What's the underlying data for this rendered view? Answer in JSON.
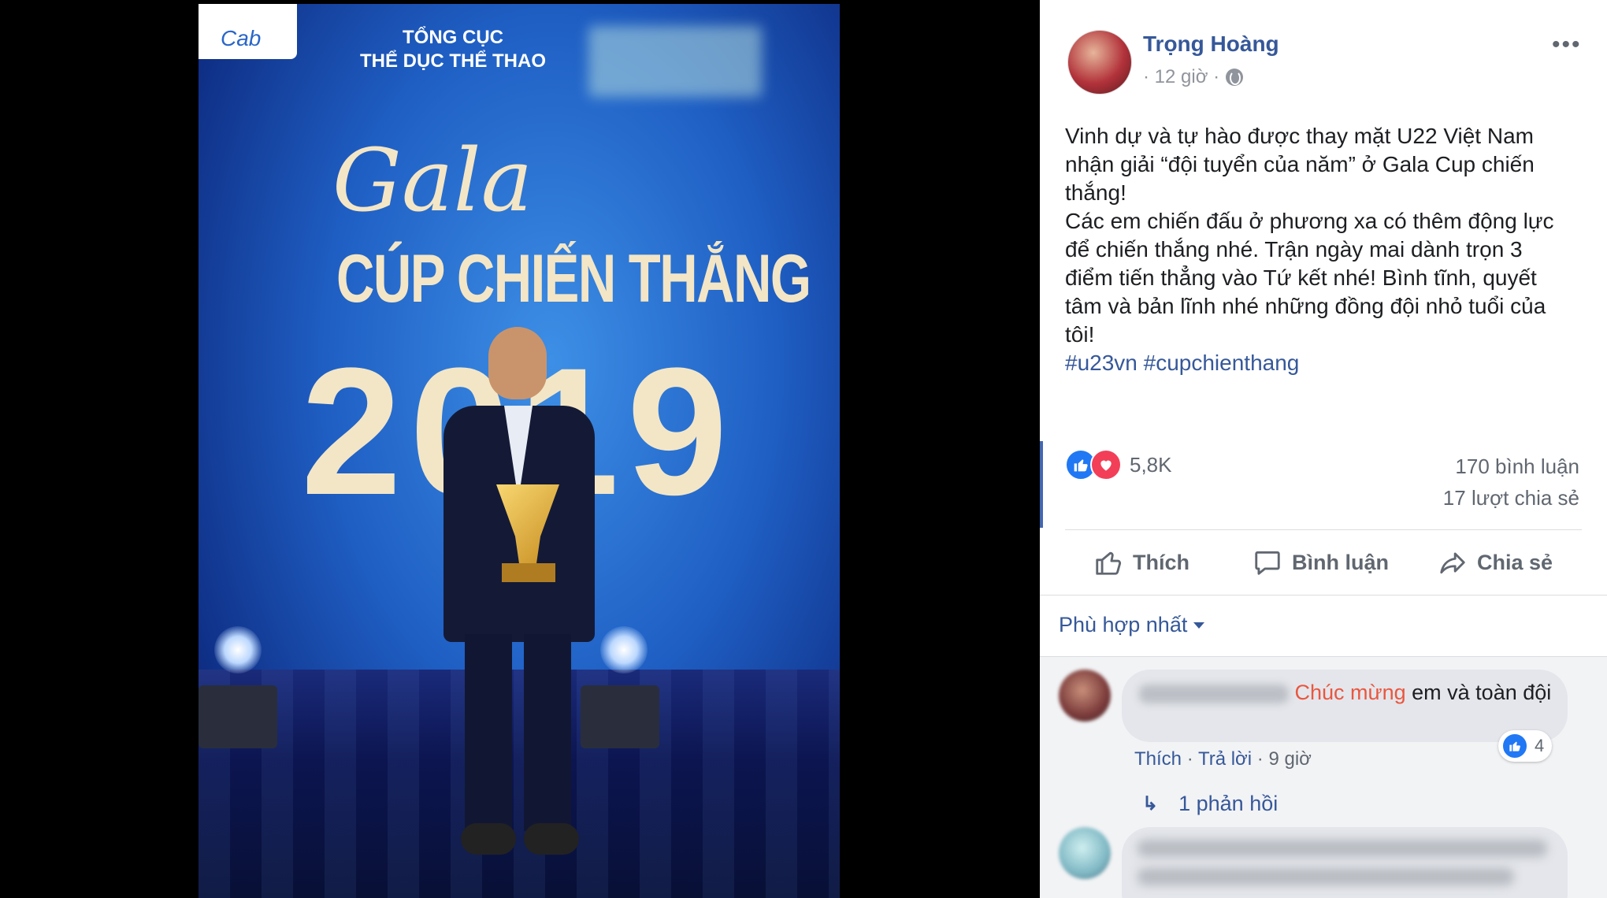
{
  "photo": {
    "org_line1": "TỔNG CỤC",
    "org_line2": "THỂ DỤC THỂ THAO",
    "brand": "Cab",
    "gala": "Gala",
    "title": "CÚP CHIẾN THẮNG",
    "year": "2019"
  },
  "post": {
    "author": "Trọng Hoàng",
    "time": "· 12 giờ ·",
    "body": "Vinh dự và tự hào được thay mặt U22 Việt Nam\nnhận giải “đội tuyển của năm” ở Gala Cup chiến\nthắng!\nCác em chiến đấu ở phương xa có thêm động lực\nđể chiến thắng nhé. Trận ngày mai dành trọn 3\nđiểm tiến thẳng vào Tứ kết nhé! Bình tĩnh, quyết\ntâm và bản lĩnh nhé những đồng đội nhỏ tuổi của\ntôi!",
    "hashtags": "#u23vn #cupchienthang",
    "more": "•••"
  },
  "stats": {
    "reactions": "5,8K",
    "comments": "170 bình luận",
    "shares": "17 lượt chia sẻ"
  },
  "actions": {
    "like": "Thích",
    "comment": "Bình luận",
    "share": "Chia sẻ"
  },
  "sort": {
    "label": "Phù hợp nhất"
  },
  "comments": [
    {
      "highlight": "Chúc mừng",
      "text": " em và toàn đội",
      "like": "Thích",
      "reply": "Trả lời",
      "time": "9 giờ",
      "reaction_count": "4",
      "replies": "1 phản hồi"
    }
  ],
  "colors": {
    "link": "#365899",
    "like_blue": "#2078f4",
    "love_red": "#f33e58",
    "highlight": "#e9573f"
  }
}
